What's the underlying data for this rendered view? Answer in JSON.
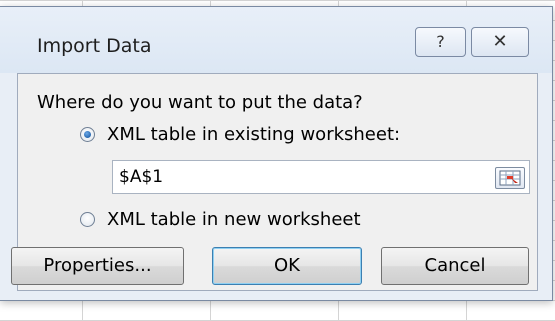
{
  "dialog": {
    "title": "Import Data",
    "help_glyph": "?",
    "close_glyph": "✕"
  },
  "prompt": "Where do you want to put the data?",
  "options": {
    "existing": {
      "label": "XML table in existing worksheet:",
      "selected": true
    },
    "new": {
      "label": "XML table in new worksheet",
      "selected": false
    }
  },
  "range_field": {
    "value": "$A$1",
    "picker_icon": "range-selector-icon"
  },
  "buttons": {
    "properties": "Properties...",
    "ok": "OK",
    "cancel": "Cancel"
  },
  "colors": {
    "dialog_frame": "#e8eef6",
    "client_bg": "#f0f0f0",
    "radio_selected": "#1f5fa8",
    "ok_border": "#3c7fb1"
  }
}
